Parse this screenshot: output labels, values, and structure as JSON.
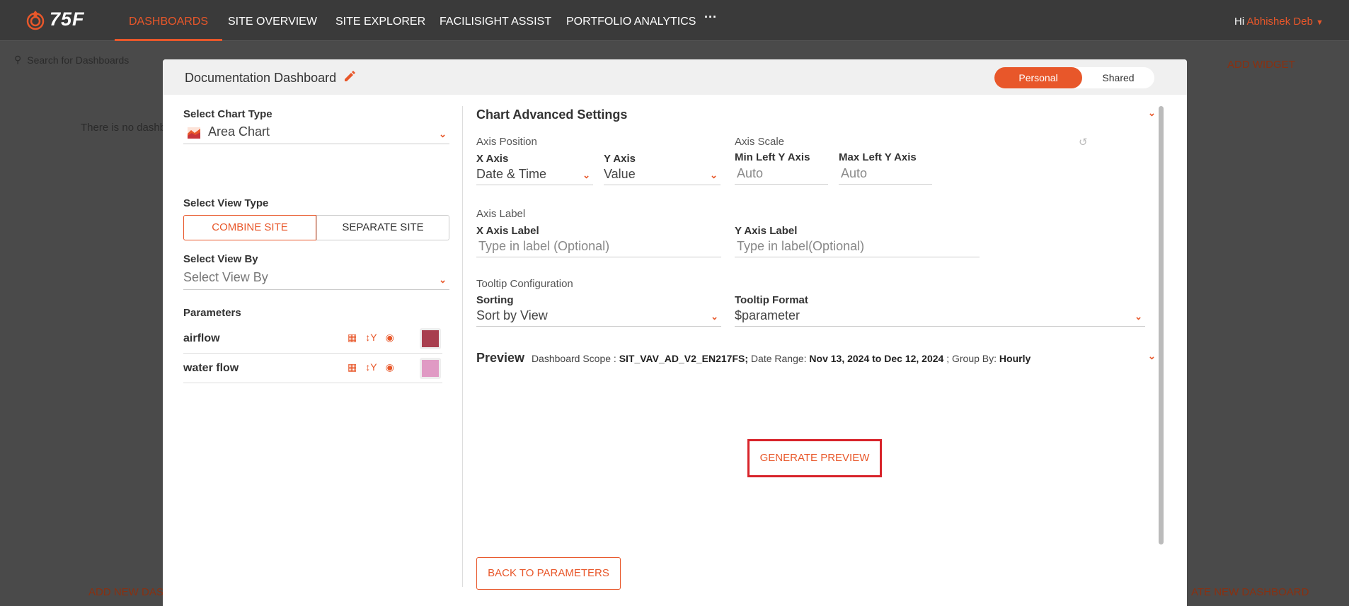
{
  "nav": {
    "logo": "75F",
    "items": [
      "DASHBOARDS",
      "SITE OVERVIEW",
      "SITE EXPLORER",
      "FACILISIGHT ASSIST",
      "PORTFOLIO ANALYTICS"
    ],
    "more": "···",
    "greeting": "Hi",
    "user": "Abhishek Deb"
  },
  "background": {
    "search_placeholder": "Search for Dashboards",
    "empty_text": "There is no dashb",
    "add_widget": "ADD WIDGET",
    "add_new_left": "ADD NEW DAS",
    "create_new_right": "ATE NEW DASHBOARD"
  },
  "modal": {
    "title": "Documentation Dashboard",
    "toggle": {
      "on": "Personal",
      "off": "Shared"
    },
    "left": {
      "chart_type_label": "Select Chart Type",
      "chart_type_value": "Area Chart",
      "view_type_label": "Select View Type",
      "combine_label": "COMBINE SITE",
      "separate_label": "SEPARATE SITE",
      "view_by_label": "Select View By",
      "view_by_placeholder": "Select View By",
      "parameters_label": "Parameters",
      "parameters": [
        {
          "name": "airflow",
          "color": "#a83e4e"
        },
        {
          "name": "water flow",
          "color": "#e09ac4"
        }
      ]
    },
    "right": {
      "title": "Chart Advanced Settings",
      "axis_position": "Axis Position",
      "x_axis_label": "X Axis",
      "x_axis_value": "Date & Time",
      "y_axis_label": "Y Axis",
      "y_axis_value": "Value",
      "axis_scale": "Axis Scale",
      "min_left_label": "Min Left Y Axis",
      "min_left_placeholder": "Auto",
      "max_left_label": "Max Left Y Axis",
      "max_left_placeholder": "Auto",
      "axis_label_head": "Axis Label",
      "x_label_field": "X Axis Label",
      "x_label_placeholder": "Type in label (Optional)",
      "y_label_field": "Y Axis Label",
      "y_label_placeholder": "Type in label(Optional)",
      "tooltip_head": "Tooltip Configuration",
      "sorting_label": "Sorting",
      "sorting_value": "Sort by View",
      "tooltip_format_label": "Tooltip Format",
      "tooltip_format_value": "$parameter",
      "preview": {
        "label": "Preview",
        "scope_prefix": "Dashboard Scope :",
        "scope": "SIT_VAV_AD_V2_EN217FS;",
        "range_prefix": "Date Range:",
        "range": "Nov 13, 2024 to Dec 12, 2024",
        "group_prefix": ";  Group By:",
        "group": "Hourly"
      },
      "generate_button": "GENERATE PREVIEW",
      "back_button": "BACK TO PARAMETERS"
    }
  },
  "colors": {
    "accent": "#e8572a",
    "highlight_border": "#d8232a"
  }
}
